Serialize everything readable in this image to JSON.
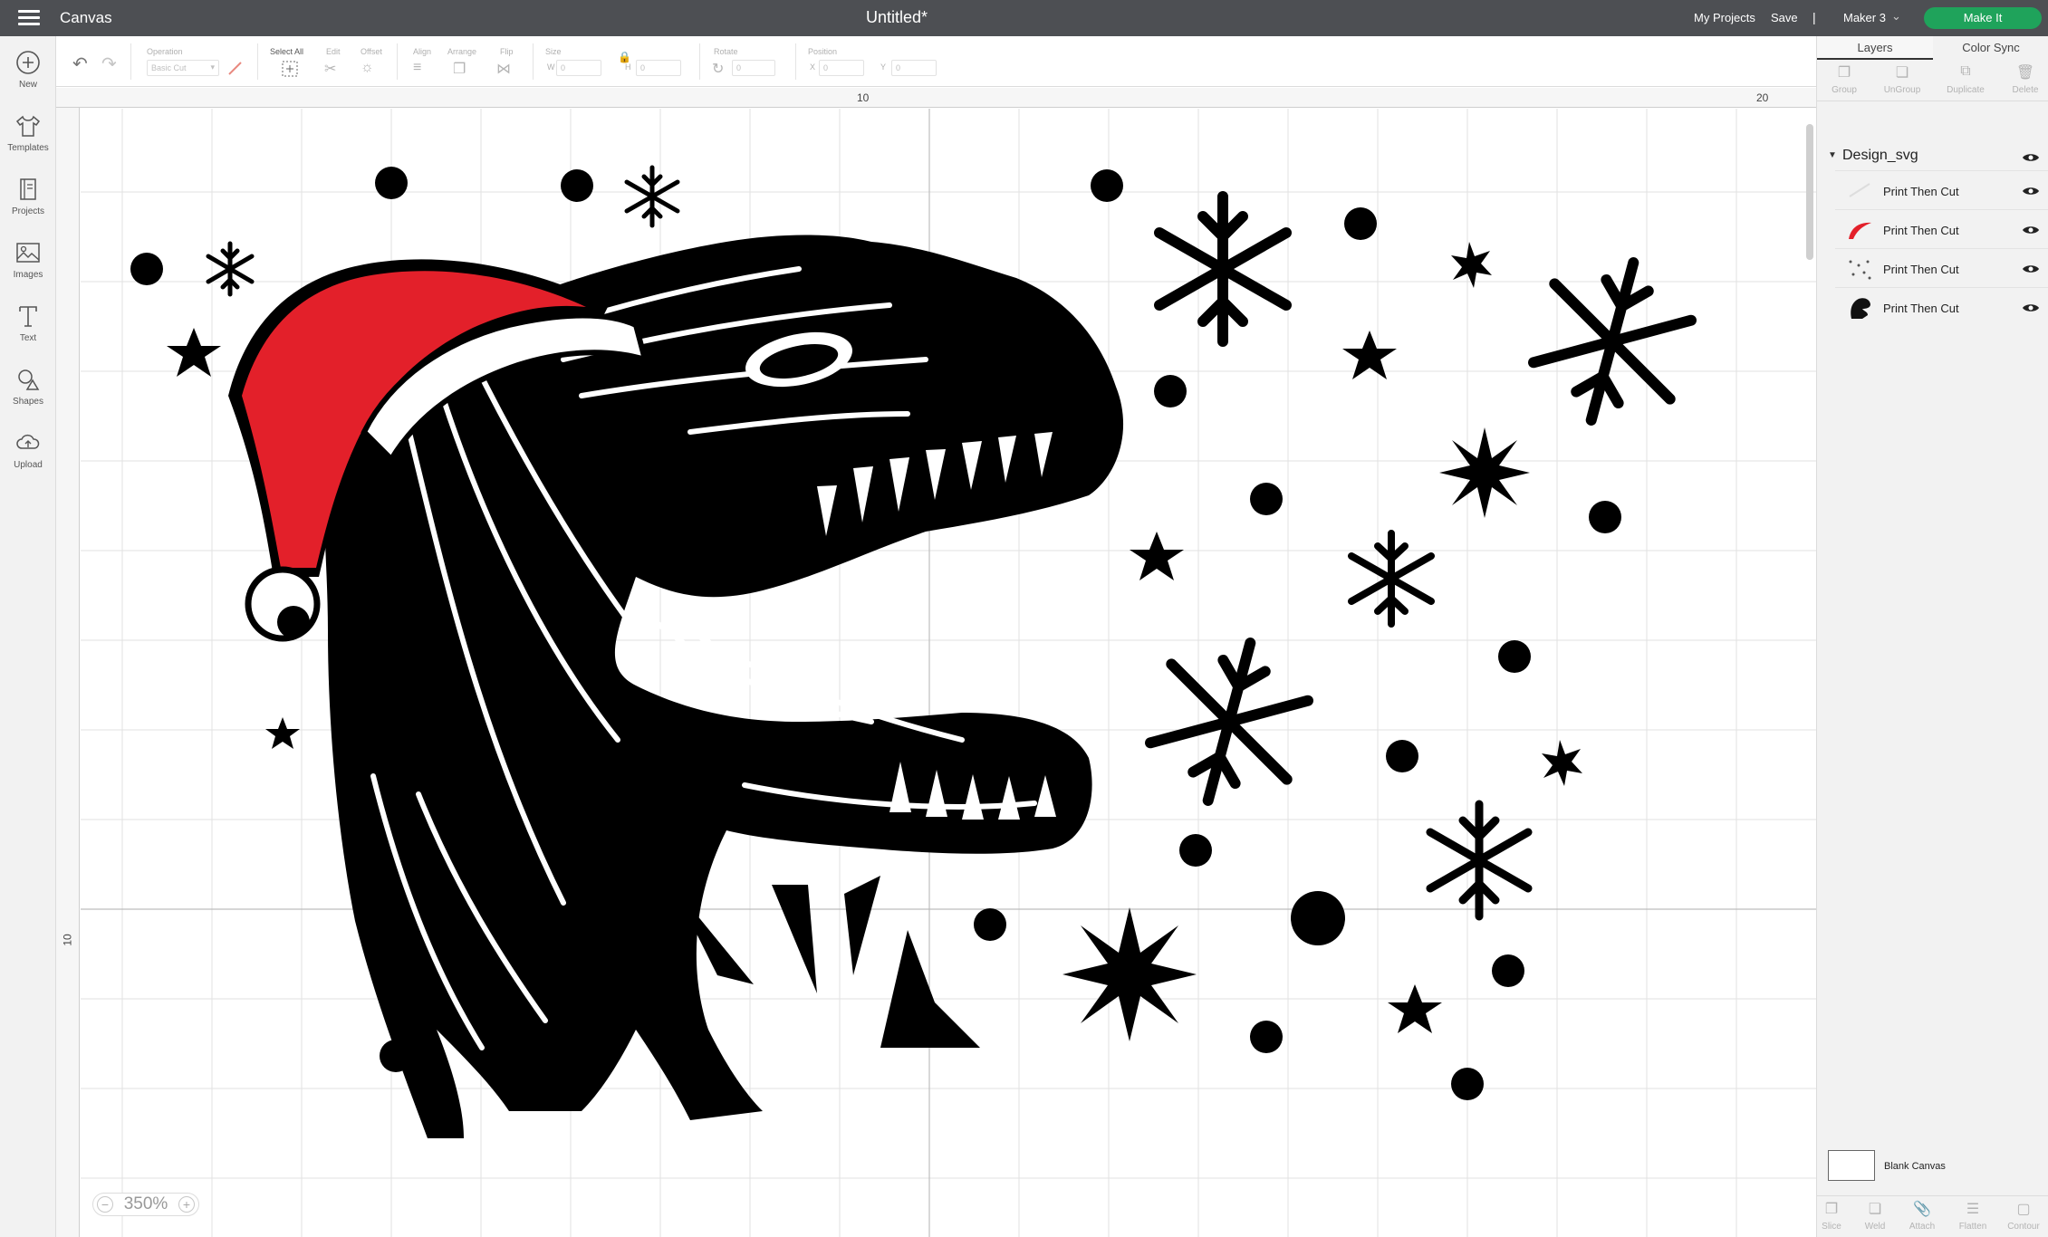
{
  "topbar": {
    "app_title": "Canvas",
    "doc_title": "Untitled*",
    "my_projects": "My Projects",
    "save": "Save",
    "divider": "|",
    "machine": "Maker 3",
    "make_it": "Make It"
  },
  "sidebar": {
    "items": [
      {
        "label": "New",
        "icon": "plus-circle-icon"
      },
      {
        "label": "Templates",
        "icon": "shirt-icon"
      },
      {
        "label": "Projects",
        "icon": "book-icon"
      },
      {
        "label": "Images",
        "icon": "image-icon"
      },
      {
        "label": "Text",
        "icon": "text-icon"
      },
      {
        "label": "Shapes",
        "icon": "shapes-icon"
      },
      {
        "label": "Upload",
        "icon": "cloud-upload-icon"
      }
    ]
  },
  "toolbar": {
    "operation_label": "Operation",
    "operation_value": "Basic Cut",
    "select_all": "Select All",
    "edit": "Edit",
    "offset": "Offset",
    "align": "Align",
    "arrange": "Arrange",
    "flip": "Flip",
    "size": "Size",
    "w": "W",
    "w_value": "0",
    "h": "H",
    "h_value": "0",
    "rotate": "Rotate",
    "rotate_value": "0",
    "position": "Position",
    "x": "X",
    "x_value": "0",
    "y": "Y",
    "y_value": "0"
  },
  "canvas": {
    "ruler_top_marks": [
      "10",
      "20"
    ],
    "ruler_left_marks": [
      "10"
    ],
    "zoom": "350%",
    "zoom_minus": "−",
    "zoom_plus": "+"
  },
  "panel": {
    "tabs": [
      "Layers",
      "Color Sync"
    ],
    "tools": [
      "Group",
      "UnGroup",
      "Duplicate",
      "Delete"
    ],
    "group_name": "Design_svg",
    "layers": [
      "Print Then Cut",
      "Print Then Cut",
      "Print Then Cut",
      "Print Then Cut"
    ],
    "blank_canvas": "Blank Canvas",
    "bottom_tools": [
      "Slice",
      "Weld",
      "Attach",
      "Flatten",
      "Contour"
    ]
  },
  "colors": {
    "topbar": "#4d4f53",
    "make_it": "#1fa35b",
    "hat_red": "#e3202a",
    "design_black": "#000000"
  }
}
